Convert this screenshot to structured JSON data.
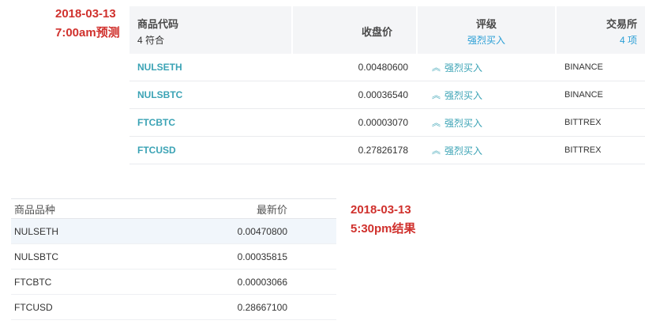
{
  "annotations": {
    "prediction": {
      "date": "2018-03-13",
      "label": "7:00am预测"
    },
    "result": {
      "date": "2018-03-13",
      "label": "5:30pm结果"
    }
  },
  "screener": {
    "headers": {
      "code": "商品代码",
      "code_sub": "4 符合",
      "close": "收盘价",
      "rating": "评级",
      "rating_sub": "强烈买入",
      "exchange": "交易所",
      "exchange_sub": "4 项"
    },
    "rows": [
      {
        "symbol": "NULSETH",
        "close": "0.00480600",
        "rating": "强烈买入",
        "exchange": "BINANCE"
      },
      {
        "symbol": "NULSBTC",
        "close": "0.00036540",
        "rating": "强烈买入",
        "exchange": "BINANCE"
      },
      {
        "symbol": "FTCBTC",
        "close": "0.00003070",
        "rating": "强烈买入",
        "exchange": "BITTREX"
      },
      {
        "symbol": "FTCUSD",
        "close": "0.27826178",
        "rating": "强烈买入",
        "exchange": "BITTREX"
      }
    ]
  },
  "results": {
    "headers": {
      "product": "商品品种",
      "latest": "最新价"
    },
    "rows": [
      {
        "product": "NULSETH",
        "latest": "0.00470800"
      },
      {
        "product": "NULSBTC",
        "latest": "0.00035815"
      },
      {
        "product": "FTCBTC",
        "latest": "0.00003066"
      },
      {
        "product": "FTCUSD",
        "latest": "0.28667100"
      }
    ]
  },
  "colors": {
    "annotation": "#d0312d",
    "symbol": "#3ba3b5",
    "header_bg": "#f4f5f7"
  },
  "icons": {
    "rating": "double-chevron-up-icon"
  }
}
